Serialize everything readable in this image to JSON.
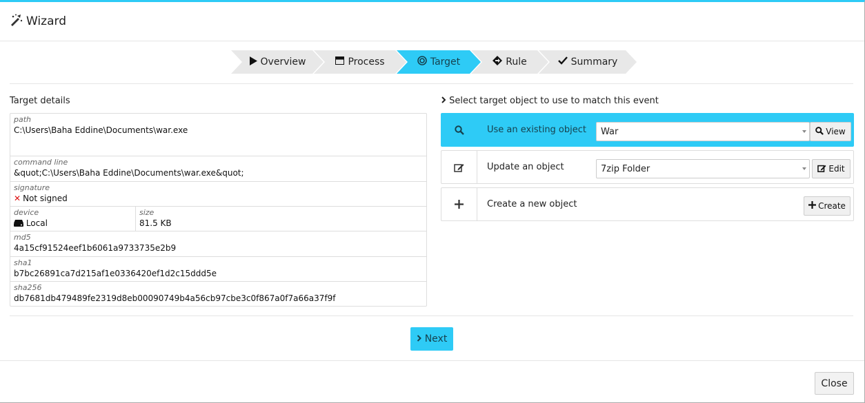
{
  "header": {
    "title": "Wizard"
  },
  "steps": [
    {
      "label": "Overview",
      "icon": "play-icon",
      "active": false
    },
    {
      "label": "Process",
      "icon": "window-icon",
      "active": false
    },
    {
      "label": "Target",
      "icon": "target-icon",
      "active": true
    },
    {
      "label": "Rule",
      "icon": "diamond-arrow-icon",
      "active": false
    },
    {
      "label": "Summary",
      "icon": "check-icon",
      "active": false
    }
  ],
  "details": {
    "title": "Target details",
    "path_label": "path",
    "path": "C:\\Users\\Baha Eddine\\Documents\\war.exe",
    "cmd_label": "command line",
    "cmd": "&quot;C:\\Users\\Baha Eddine\\Documents\\war.exe&quot;",
    "sig_label": "signature",
    "sig": "Not signed",
    "device_label": "device",
    "device": "Local",
    "size_label": "size",
    "size": "81.5 KB",
    "md5_label": "md5",
    "md5": "4a15cf91524eef1b6061a9733735e2b9",
    "sha1_label": "sha1",
    "sha1": "b7bc26891ca7d215af1e0336420ef1d2c15ddd5e",
    "sha256_label": "sha256",
    "sha256": "db7681db479489fe2319d8eb00090749b4a56cb97cbe3c0f867a0f7a66a37f9f"
  },
  "select": {
    "title": "Select target object to use to match this event",
    "existing_label": "Use an existing object",
    "existing_value": "War",
    "view_label": "View",
    "update_label": "Update an object",
    "update_value": "7zip Folder",
    "edit_label": "Edit",
    "create_label": "Create a new object",
    "create_btn": "Create"
  },
  "next_label": "Next",
  "close_label": "Close",
  "colors": {
    "accent": "#2ecbf6",
    "error": "#dd1111"
  }
}
